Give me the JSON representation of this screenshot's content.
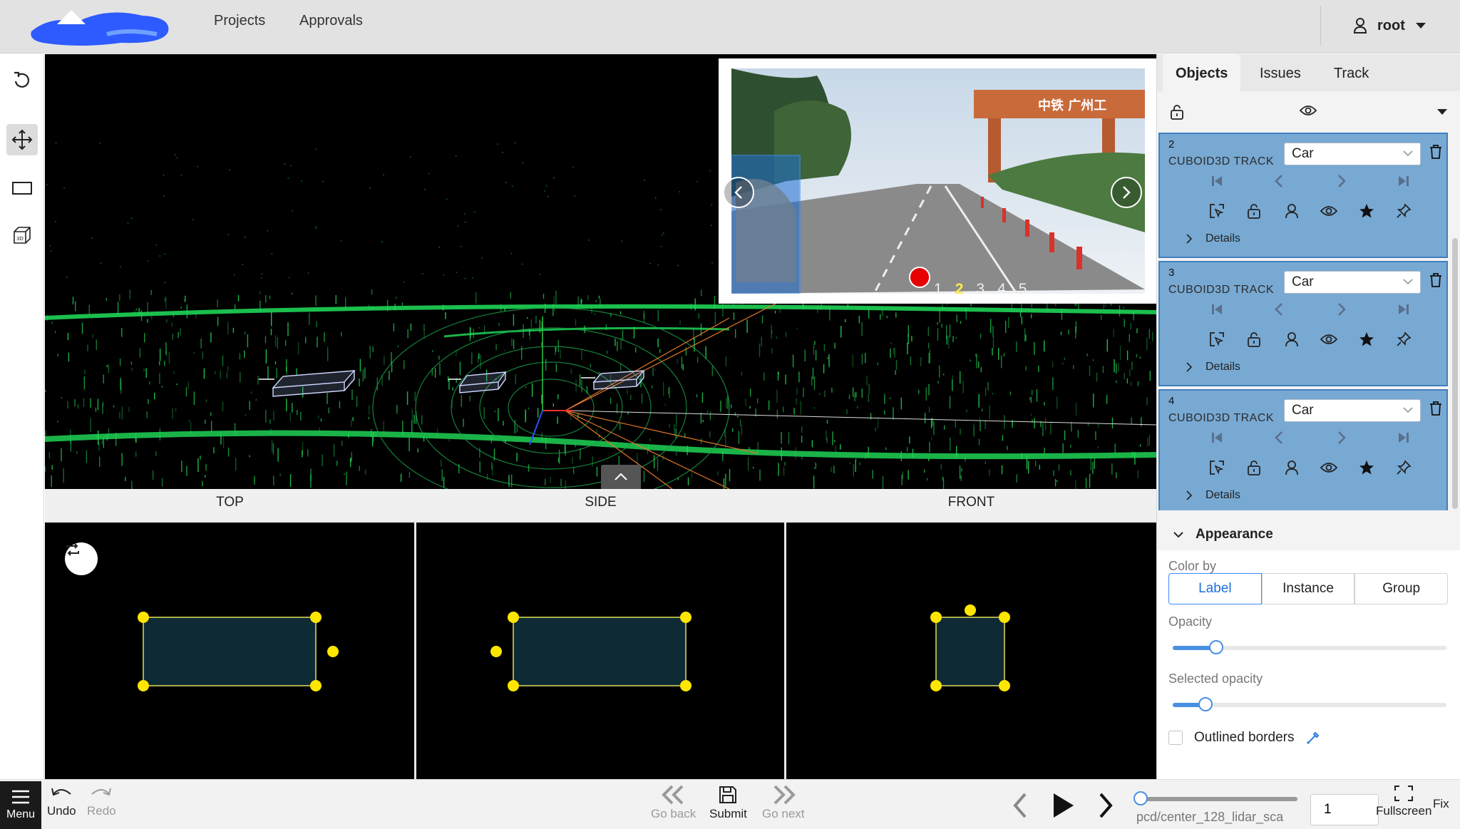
{
  "nav": {
    "projects": "Projects",
    "approvals": "Approvals",
    "user": "root"
  },
  "tools": [
    "undo-rotate",
    "move",
    "rectangle",
    "cube-3d"
  ],
  "camera": {
    "pages": [
      "1",
      "2",
      "3",
      "4",
      "5"
    ],
    "current_page": "2"
  },
  "views": {
    "top": "TOP",
    "side": "SIDE",
    "front": "FRONT"
  },
  "panel": {
    "tabs": [
      "Objects",
      "Issues",
      "Track"
    ],
    "active_tab": "Objects",
    "objects": [
      {
        "id": "2",
        "type": "CUBOID3D TRACK",
        "label": "Car",
        "details": "Details"
      },
      {
        "id": "3",
        "type": "CUBOID3D TRACK",
        "label": "Car",
        "details": "Details"
      },
      {
        "id": "4",
        "type": "CUBOID3D TRACK",
        "label": "Car",
        "details": "Details"
      }
    ],
    "appearance": {
      "title": "Appearance",
      "color_by_label": "Color by",
      "color_by_options": [
        "Label",
        "Instance",
        "Group"
      ],
      "color_by_selected": "Label",
      "opacity_label": "Opacity",
      "opacity_value": 0.16,
      "selected_opacity_label": "Selected opacity",
      "selected_opacity_value": 0.12,
      "outlined_borders_label": "Outlined borders",
      "outlined_borders_checked": false
    }
  },
  "bottom": {
    "menu": "Menu",
    "undo": "Undo",
    "redo": "Redo",
    "go_back": "Go back",
    "submit": "Submit",
    "go_next": "Go next",
    "file_name": "pcd/center_128_lidar_sca",
    "frame_value": "1",
    "fullscreen": "Fullscreen",
    "fit": "Fix"
  },
  "colors": {
    "accent": "#4a90e2",
    "object_card": "#78a9d3",
    "point_cloud": "#22e05a",
    "handle": "#ffe600"
  }
}
